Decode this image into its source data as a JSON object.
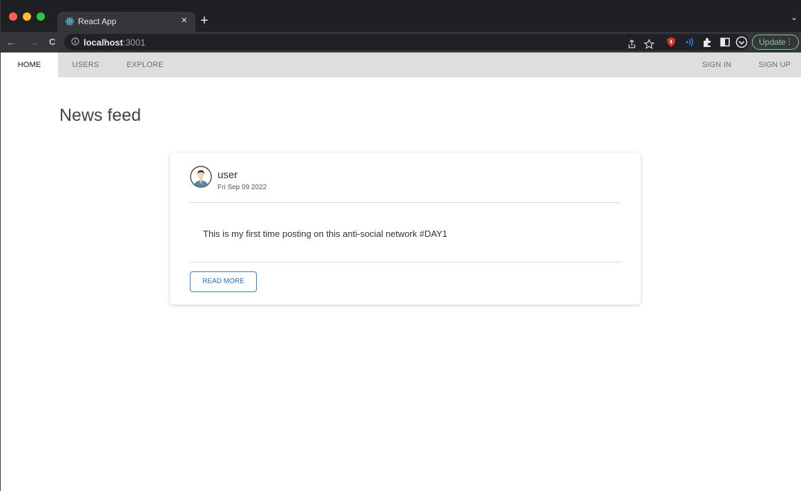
{
  "browser": {
    "tab": {
      "title": "React App",
      "close_glyph": "×",
      "favicon": "react-icon"
    },
    "new_tab_glyph": "+",
    "tab_menu_glyph": "⌄",
    "url": {
      "host": "localhost",
      "port": ":3001"
    },
    "nav": {
      "back": "←",
      "forward": "→",
      "reload": "C"
    },
    "update_button": {
      "label": "Update",
      "menu_glyph": "⋮"
    },
    "colors": {
      "frame": "#1f2023",
      "toolbar": "#35363a",
      "omnibox": "#202124",
      "update": "#81c995"
    }
  },
  "appbar": {
    "items": [
      {
        "label": "HOME",
        "active": true
      },
      {
        "label": "USERS"
      },
      {
        "label": "EXPLORE"
      }
    ],
    "right_items": [
      {
        "label": "SIGN IN"
      },
      {
        "label": "SIGN UP"
      }
    ],
    "background": "#dedede"
  },
  "page": {
    "title": "News feed"
  },
  "post": {
    "author": "user",
    "date": "Fri Sep 09 2022",
    "text": "This is my first time posting on this anti-social network #DAY1",
    "button_label": "READ MORE",
    "accent": "#2f80ed"
  }
}
